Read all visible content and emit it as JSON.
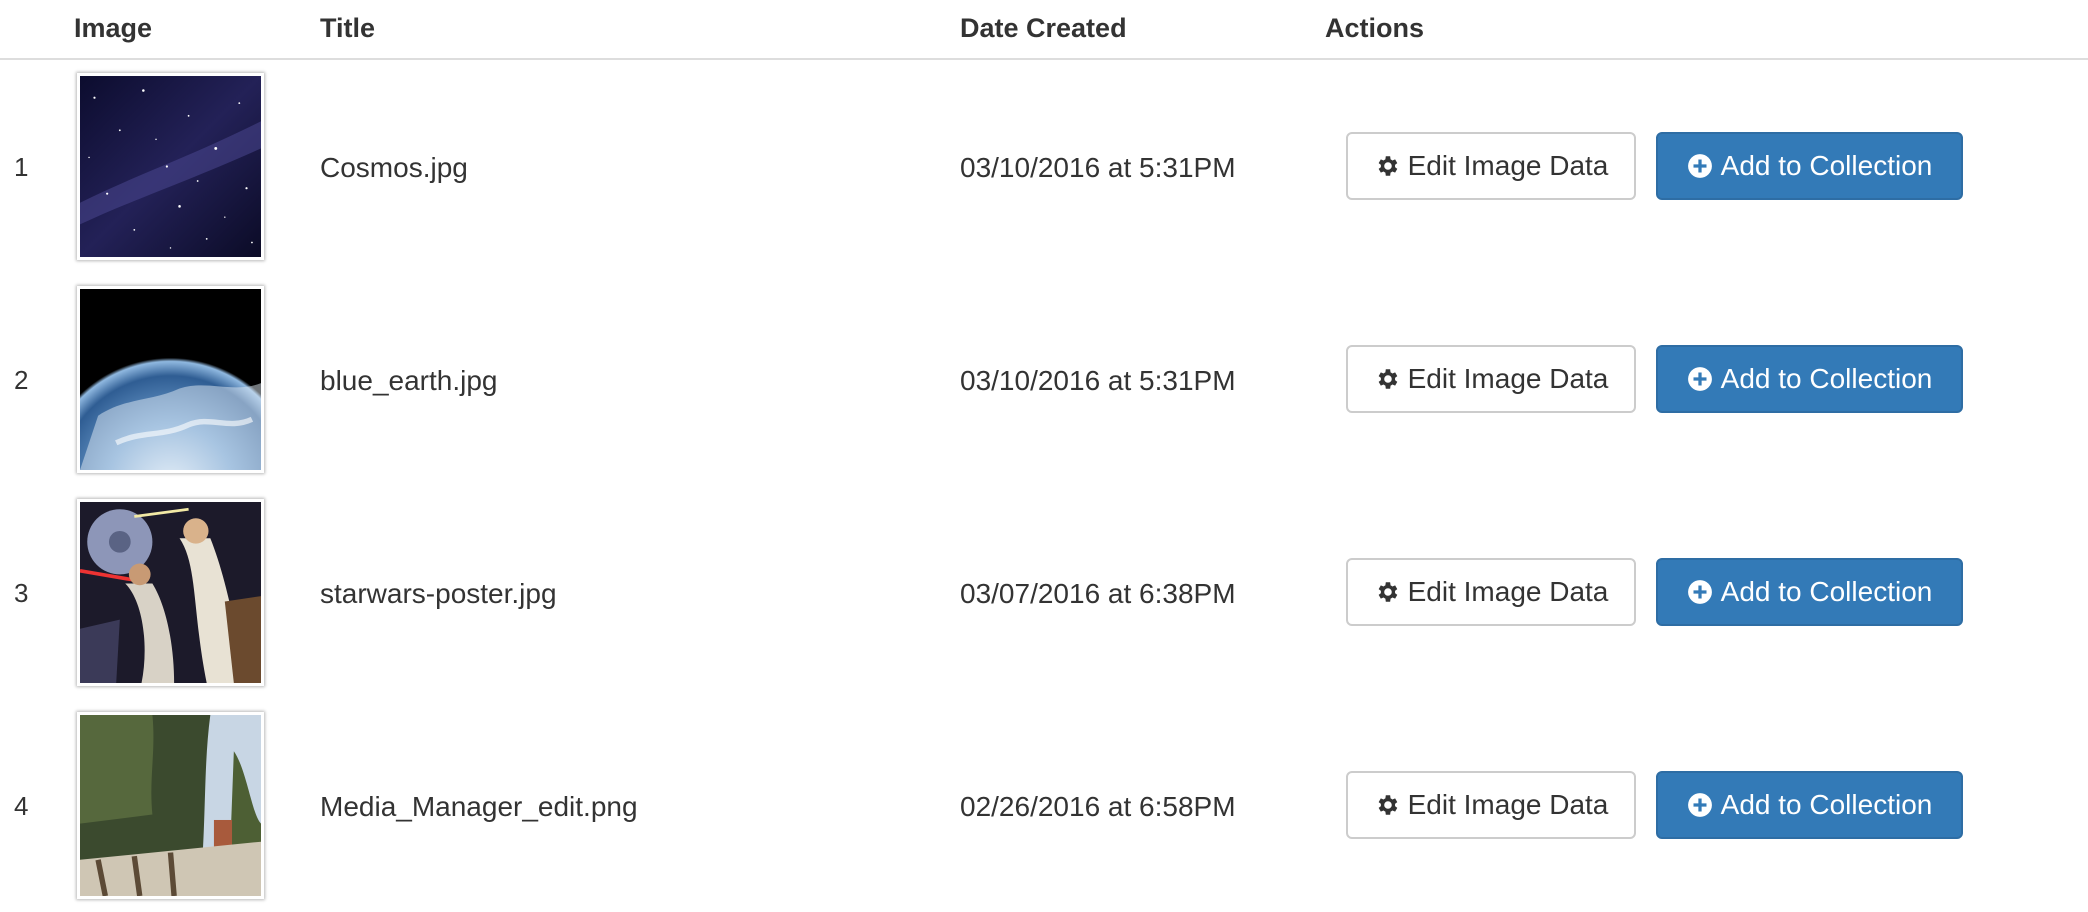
{
  "table": {
    "headers": {
      "image": "Image",
      "title": "Title",
      "date": "Date Created",
      "actions": "Actions"
    },
    "rows": [
      {
        "num": "1",
        "title": "Cosmos.jpg",
        "date": "03/10/2016 at 5:31PM",
        "edit_label": "Edit Image Data",
        "add_label": "Add to Collection",
        "thumb": "starfield"
      },
      {
        "num": "2",
        "title": "blue_earth.jpg",
        "date": "03/10/2016 at 5:31PM",
        "edit_label": "Edit Image Data",
        "add_label": "Add to Collection",
        "thumb": "earth"
      },
      {
        "num": "3",
        "title": "starwars-poster.jpg",
        "date": "03/07/2016 at 6:38PM",
        "edit_label": "Edit Image Data",
        "add_label": "Add to Collection",
        "thumb": "poster"
      },
      {
        "num": "4",
        "title": "Media_Manager_edit.png",
        "date": "02/26/2016 at 6:58PM",
        "edit_label": "Edit Image Data",
        "add_label": "Add to Collection",
        "thumb": "trees"
      }
    ]
  },
  "icons": {
    "edit": "gear-icon",
    "add": "plus-circle-icon"
  },
  "colors": {
    "primary": "#337ab7",
    "primary_border": "#2e6da4",
    "default_border": "#cccccc",
    "text": "#333333",
    "rule": "#dddddd"
  }
}
